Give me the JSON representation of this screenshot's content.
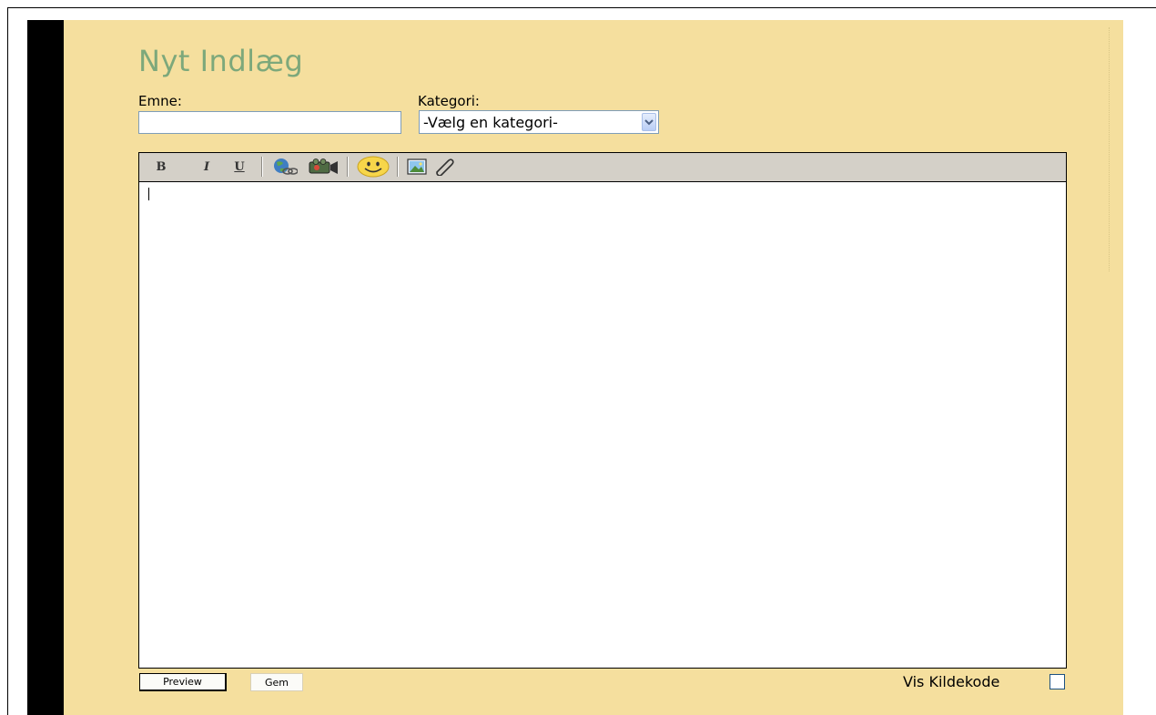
{
  "page": {
    "title": "Nyt Indlæg"
  },
  "form": {
    "emne_label": "Emne:",
    "emne_value": "",
    "kategori_label": "Kategori:",
    "kategori_selected": "-Vælg en kategori-"
  },
  "toolbar": {
    "bold_label": "B",
    "italic_label": "I",
    "underline_label": "U",
    "icons": [
      "link-icon",
      "video-icon",
      "smiley-icon",
      "image-icon",
      "attachment-icon"
    ]
  },
  "editor": {
    "content": ""
  },
  "actions": {
    "preview_label": "Preview",
    "save_label": "Gem",
    "view_source_label": "Vis Kildekode"
  },
  "colors": {
    "panel_background": "#f5df9e",
    "title_color": "#7da87b",
    "toolbar_background": "#d4d0c8"
  }
}
